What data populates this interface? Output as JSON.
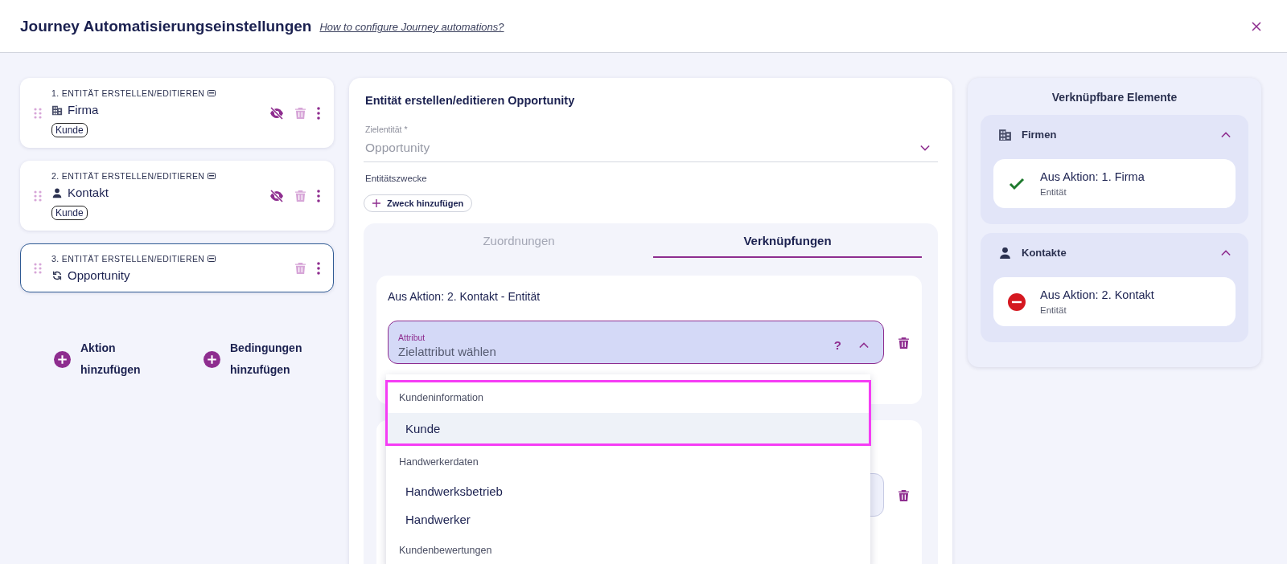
{
  "dialog": {
    "title": "Journey Automatisierungseinstellungen",
    "help_link": "How to configure Journey automations?"
  },
  "actions": [
    {
      "step": "1. ENTITÄT ERSTELLEN/EDITIEREN",
      "entity": "Firma",
      "kind": "company",
      "tags": [
        "Kunde"
      ],
      "hidden": true,
      "selected": false
    },
    {
      "step": "2. ENTITÄT ERSTELLEN/EDITIEREN",
      "entity": "Kontakt",
      "kind": "contact",
      "tags": [
        "Kunde"
      ],
      "hidden": true,
      "selected": false
    },
    {
      "step": "3. ENTITÄT ERSTELLEN/EDITIEREN",
      "entity": "Opportunity",
      "kind": "opportunity",
      "hidden": false,
      "selected": true
    }
  ],
  "add_buttons": [
    "Aktion hinzufügen",
    "Bedingungen hinzufügen"
  ],
  "editor": {
    "title": "Entität erstellen/editieren Opportunity",
    "target_field": {
      "label": "Zielentität *",
      "value": "Opportunity"
    },
    "purposes_label": "Entitätszwecke",
    "add_purpose_button": "Zweck hinzufügen",
    "tabs": [
      {
        "label": "Zuordnungen",
        "selected": false
      },
      {
        "label": "Verknüpfungen",
        "selected": true
      }
    ],
    "links": [
      {
        "source": "Aus Aktion: 2. Kontakt - Entität",
        "field": {
          "label": "Attribut",
          "placeholder": "Zielattribut wählen",
          "help": "?",
          "expanded": true
        }
      },
      {
        "field": {
          "expanded": false
        }
      }
    ],
    "dropdown": [
      {
        "label": "Kundeninformation",
        "highlighted": true,
        "options": [
          {
            "label": "Kunde",
            "selected": true
          }
        ]
      },
      {
        "label": "Handwerkerdaten",
        "highlighted": false,
        "options": [
          {
            "label": "Handwerksbetrieb",
            "selected": false
          },
          {
            "label": "Handwerker",
            "selected": false
          }
        ]
      },
      {
        "label": "Kundenbewertungen",
        "highlighted": false
      }
    ]
  },
  "linkable": {
    "title": "Verknüpfbare Elemente",
    "sections": [
      {
        "label": "Firmen",
        "kind": "company",
        "expanded": true,
        "items": [
          {
            "title": "Aus Aktion: 1. Firma",
            "subtitle": "Entität",
            "kind": "ok"
          }
        ]
      },
      {
        "label": "Kontakte",
        "kind": "contact",
        "expanded": true,
        "items": [
          {
            "title": "Aus Aktion: 2. Kontakt",
            "subtitle": "Entität",
            "kind": "blocked"
          }
        ]
      }
    ]
  }
}
